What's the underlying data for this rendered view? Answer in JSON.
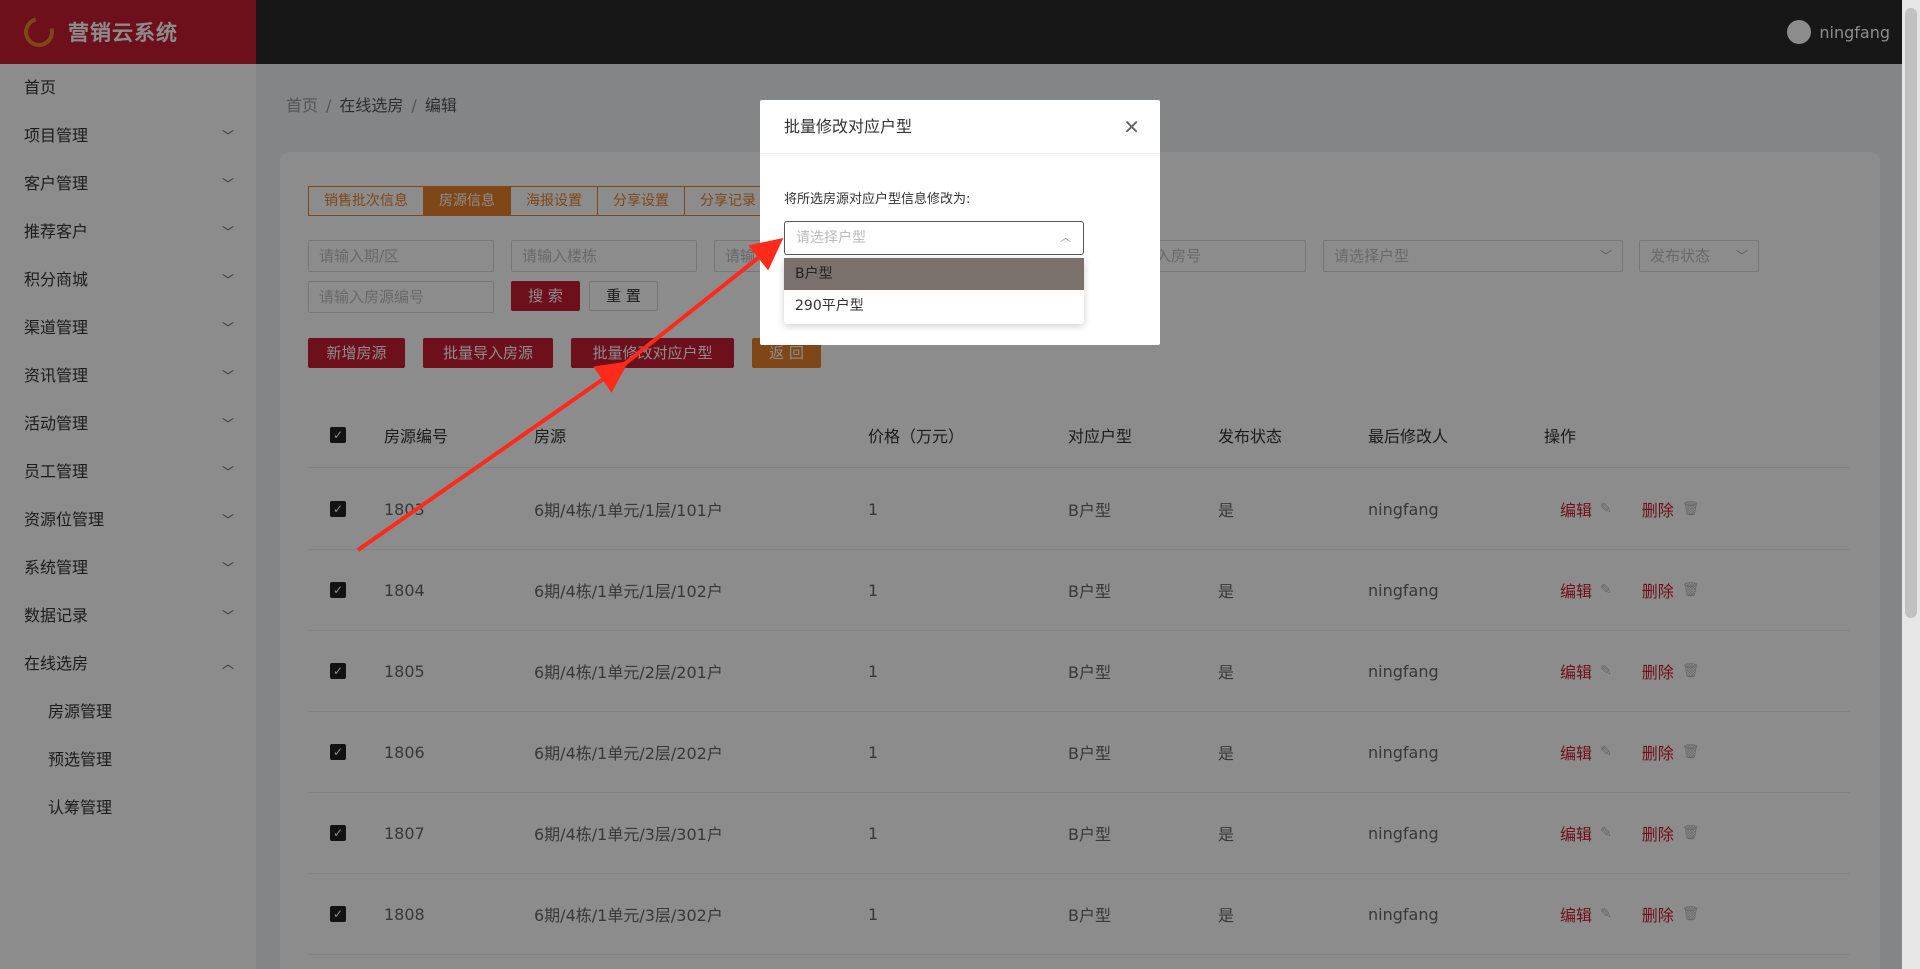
{
  "app": {
    "title": "营销云系统",
    "username": "ningfang"
  },
  "sidebar": {
    "items": [
      {
        "label": "首页",
        "expandable": false
      },
      {
        "label": "项目管理",
        "expandable": true
      },
      {
        "label": "客户管理",
        "expandable": true
      },
      {
        "label": "推荐客户",
        "expandable": true
      },
      {
        "label": "积分商城",
        "expandable": true
      },
      {
        "label": "渠道管理",
        "expandable": true
      },
      {
        "label": "资讯管理",
        "expandable": true
      },
      {
        "label": "活动管理",
        "expandable": true
      },
      {
        "label": "员工管理",
        "expandable": true
      },
      {
        "label": "资源位管理",
        "expandable": true
      },
      {
        "label": "系统管理",
        "expandable": true
      },
      {
        "label": "数据记录",
        "expandable": true
      },
      {
        "label": "在线选房",
        "expandable": true,
        "expanded": true
      }
    ],
    "submenu": [
      "房源管理",
      "预选管理",
      "认筹管理"
    ]
  },
  "breadcrumb": [
    "首页",
    "在线选房",
    "编辑"
  ],
  "tabs": [
    "销售批次信息",
    "房源信息",
    "海报设置",
    "分享设置",
    "分享记录"
  ],
  "active_tab": "房源信息",
  "filters": {
    "period": "请输入期/区",
    "building": "请输入楼栋",
    "unit": "请输",
    "room": "入房号",
    "house_type": "请选择户型",
    "status": "发布状态",
    "code": "请输入房源编号"
  },
  "buttons": {
    "search": "搜 索",
    "reset": "重 置",
    "add": "新增房源",
    "import": "批量导入房源",
    "batch_edit": "批量修改对应户型",
    "back": "返 回"
  },
  "table": {
    "columns": [
      "房源编号",
      "房源",
      "价格（万元）",
      "对应户型",
      "发布状态",
      "最后修改人",
      "操作"
    ],
    "rows": [
      {
        "code": "1803",
        "house": "6期/4栋/1单元/1层/101户",
        "price": "1",
        "type": "B户型",
        "published": "是",
        "editor": "ningfang"
      },
      {
        "code": "1804",
        "house": "6期/4栋/1单元/1层/102户",
        "price": "1",
        "type": "B户型",
        "published": "是",
        "editor": "ningfang"
      },
      {
        "code": "1805",
        "house": "6期/4栋/1单元/2层/201户",
        "price": "1",
        "type": "B户型",
        "published": "是",
        "editor": "ningfang"
      },
      {
        "code": "1806",
        "house": "6期/4栋/1单元/2层/202户",
        "price": "1",
        "type": "B户型",
        "published": "是",
        "editor": "ningfang"
      },
      {
        "code": "1807",
        "house": "6期/4栋/1单元/3层/301户",
        "price": "1",
        "type": "B户型",
        "published": "是",
        "editor": "ningfang"
      },
      {
        "code": "1808",
        "house": "6期/4栋/1单元/3层/302户",
        "price": "1",
        "type": "B户型",
        "published": "是",
        "editor": "ningfang"
      }
    ],
    "edit_label": "编辑",
    "delete_label": "删除"
  },
  "modal": {
    "title": "批量修改对应户型",
    "label": "将所选房源对应户型信息修改为:",
    "placeholder": "请选择户型",
    "options": [
      "B户型",
      "290平户型"
    ],
    "highlighted_option": "B户型"
  },
  "colors": {
    "brand_red": "#c81e34",
    "accent_orange": "#e8812a",
    "arrow_red": "#ff2a1a"
  }
}
